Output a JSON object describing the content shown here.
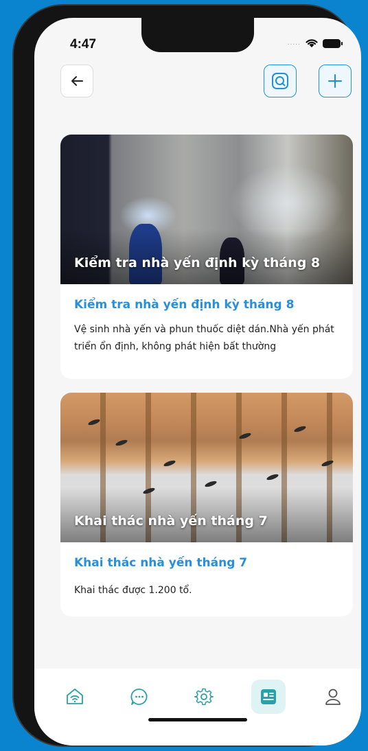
{
  "status_bar": {
    "time": "4:47",
    "dots": "....."
  },
  "header": {
    "back_icon": "arrow-left-icon",
    "search_icon": "search-icon",
    "add_icon": "plus-icon"
  },
  "posts": [
    {
      "image_caption": "Kiểm tra nhà yến định kỳ tháng 8",
      "title": "Kiểm tra nhà yến định kỳ tháng 8",
      "description": "Vệ sinh nhà yến và phun thuốc diệt dán.Nhà yến phát triển ổn định, không phát hiện bất thường"
    },
    {
      "image_caption": "Khai thác nhà yến tháng 7",
      "title": "Khai thác nhà yến tháng 7",
      "description": "Khai thác được 1.200 tổ."
    }
  ],
  "tabbar": {
    "items": [
      {
        "icon": "home-wifi-icon",
        "active": false
      },
      {
        "icon": "chat-icon",
        "active": false
      },
      {
        "icon": "gear-icon",
        "active": false
      },
      {
        "icon": "news-icon",
        "active": true
      },
      {
        "icon": "user-icon",
        "active": false
      }
    ]
  },
  "colors": {
    "accent": "#2b8fd6",
    "active_tab_bg": "#dff3f4",
    "tab_icon": "#2aa1a8"
  }
}
